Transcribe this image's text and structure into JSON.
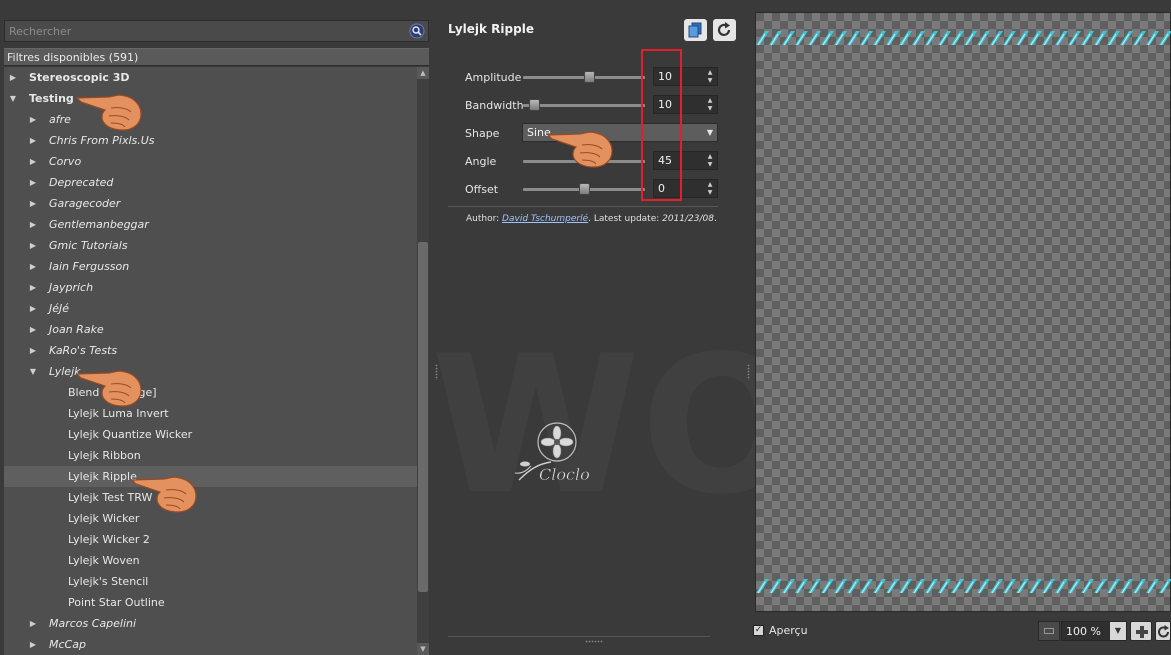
{
  "search": {
    "placeholder": "Rechercher"
  },
  "tree": {
    "header": "Filtres disponibles (591)",
    "rows": [
      {
        "label": "Stereoscopic 3D",
        "level": 0,
        "expanded": false,
        "style": "bold"
      },
      {
        "label": "Testing",
        "level": 0,
        "expanded": true,
        "style": "bold"
      },
      {
        "label": "afre",
        "level": 1,
        "expanded": false,
        "style": "italic"
      },
      {
        "label": "Chris From Pixls.Us",
        "level": 1,
        "expanded": false,
        "style": "italic"
      },
      {
        "label": "Corvo",
        "level": 1,
        "expanded": false,
        "style": "italic"
      },
      {
        "label": "Deprecated",
        "level": 1,
        "expanded": false,
        "style": "italic"
      },
      {
        "label": "Garagecoder",
        "level": 1,
        "expanded": false,
        "style": "italic"
      },
      {
        "label": "Gentlemanbeggar",
        "level": 1,
        "expanded": false,
        "style": "italic"
      },
      {
        "label": "Gmic Tutorials",
        "level": 1,
        "expanded": false,
        "style": "italic"
      },
      {
        "label": "Iain Fergusson",
        "level": 1,
        "expanded": false,
        "style": "italic"
      },
      {
        "label": "Jayprich",
        "level": 1,
        "expanded": false,
        "style": "italic"
      },
      {
        "label": "JéJé",
        "level": 1,
        "expanded": false,
        "style": "italic"
      },
      {
        "label": "Joan Rake",
        "level": 1,
        "expanded": false,
        "style": "italic"
      },
      {
        "label": "KaRo's Tests",
        "level": 1,
        "expanded": false,
        "style": "italic"
      },
      {
        "label": "Lylejk",
        "level": 1,
        "expanded": true,
        "style": "italic"
      },
      {
        "label": "Blend [Average]",
        "level": 2,
        "style": "normal"
      },
      {
        "label": "Lylejk Luma Invert",
        "level": 2,
        "style": "normal"
      },
      {
        "label": "Lylejk Quantize Wicker",
        "level": 2,
        "style": "normal"
      },
      {
        "label": "Lylejk Ribbon",
        "level": 2,
        "style": "normal"
      },
      {
        "label": "Lylejk Ripple",
        "level": 2,
        "style": "normal",
        "selected": true
      },
      {
        "label": "Lylejk Test TRW",
        "level": 2,
        "style": "normal"
      },
      {
        "label": "Lylejk Wicker",
        "level": 2,
        "style": "normal"
      },
      {
        "label": "Lylejk Wicker 2",
        "level": 2,
        "style": "normal"
      },
      {
        "label": "Lylejk Woven",
        "level": 2,
        "style": "normal"
      },
      {
        "label": "Lylejk's Stencil",
        "level": 2,
        "style": "normal"
      },
      {
        "label": "Point Star Outline",
        "level": 2,
        "style": "normal"
      },
      {
        "label": "Marcos Capelini",
        "level": 1,
        "expanded": false,
        "style": "italic"
      },
      {
        "label": "McCap",
        "level": 1,
        "expanded": false,
        "style": "italic"
      }
    ]
  },
  "filter": {
    "title": "Lylejk Ripple",
    "icons": {
      "copy": "copy-to-clipboard-icon",
      "reset": "reset-icon"
    },
    "params": {
      "amplitude": {
        "label": "Amplitude",
        "value": "10",
        "level": 0.55
      },
      "bandwidth": {
        "label": "Bandwidth",
        "value": "10",
        "level": 0.05
      },
      "shape": {
        "label": "Shape",
        "value": "Sine"
      },
      "angle": {
        "label": "Angle",
        "value": "45",
        "level": 0.55
      },
      "offset": {
        "label": "Offset",
        "value": "0",
        "level": 0.5
      }
    },
    "author_prefix": "Author: ",
    "author_name": "David Tschumperlé",
    "update_prefix": ". Latest update: ",
    "update_date": "2011/23/08",
    "update_suffix": "."
  },
  "preview": {
    "apercu_label": "Aperçu",
    "apercu_checked": true,
    "zoom_value": "100 %"
  },
  "colors": {
    "ripple": "#3fc6d6",
    "highlight_box": "#e0202a"
  }
}
